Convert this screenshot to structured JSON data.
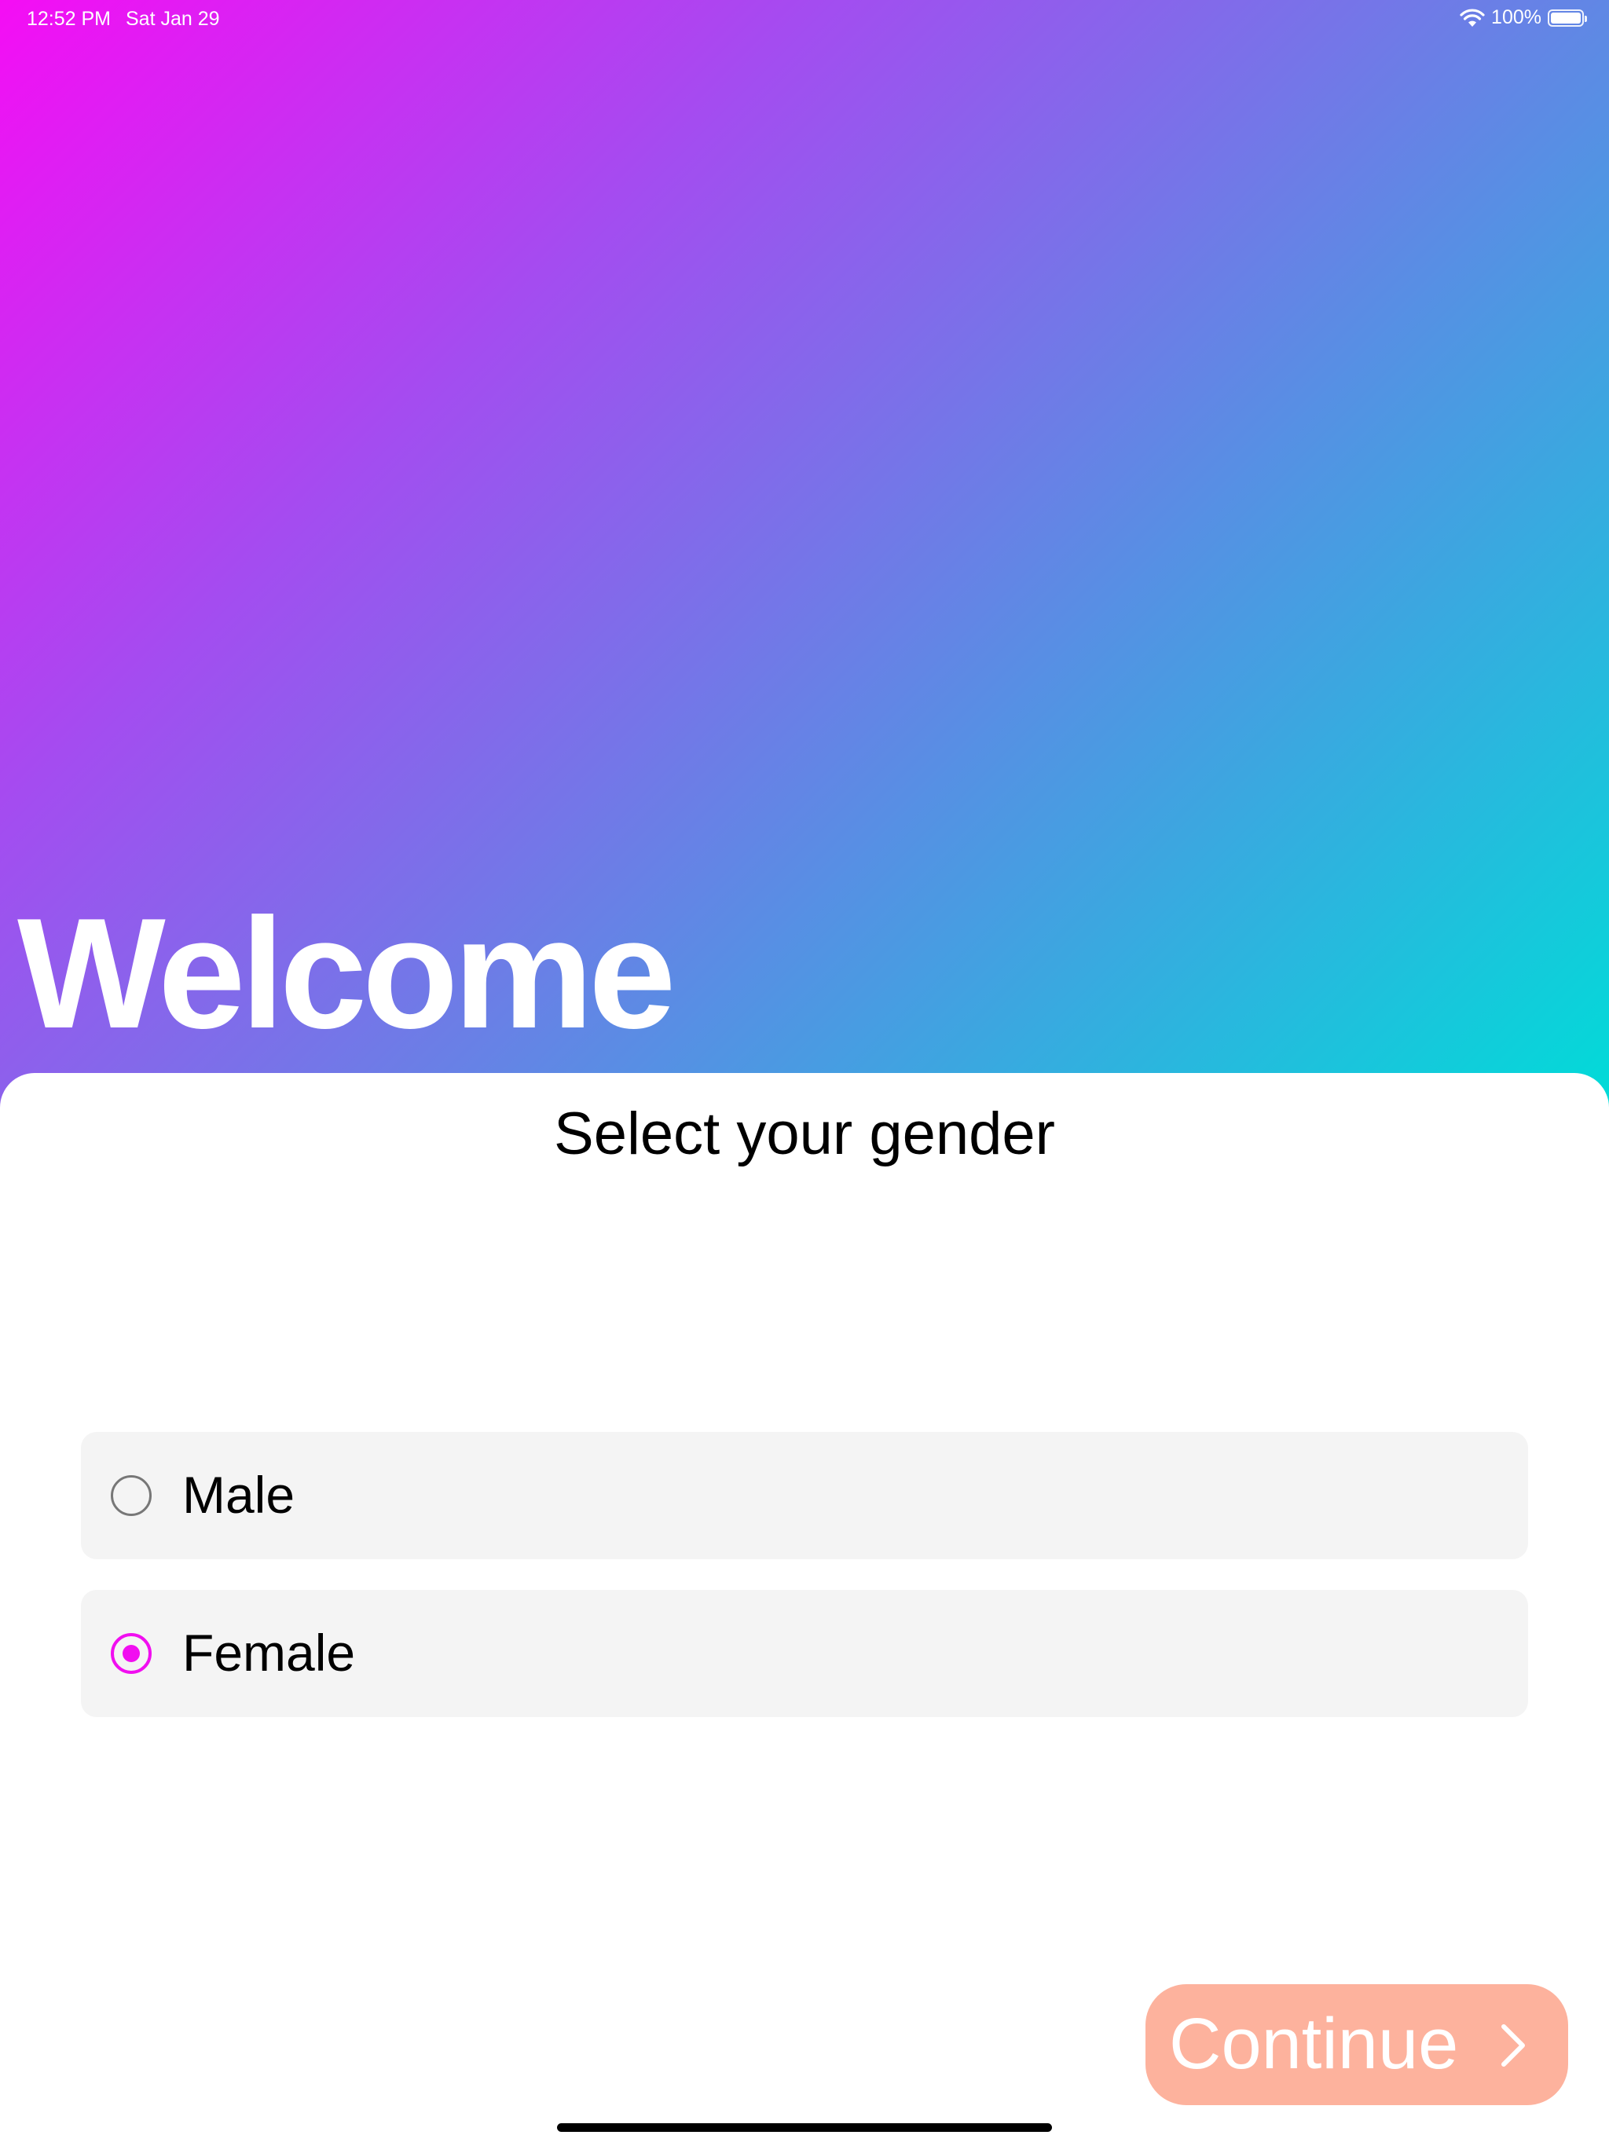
{
  "status_bar": {
    "time": "12:52 PM",
    "date": "Sat Jan 29",
    "battery": "100%",
    "battery_level": 1.0,
    "icons": [
      "wifi-icon",
      "battery-icon"
    ]
  },
  "hero": {
    "title": "Welcome",
    "gradient_colors": [
      "#f50df4",
      "#a44cf0",
      "#6a7fe6",
      "#3aa8e0",
      "#00dcd8"
    ]
  },
  "gender_form": {
    "title": "Select your gender",
    "options": [
      {
        "label": "Male",
        "selected": false
      },
      {
        "label": "Female",
        "selected": true
      }
    ],
    "selected_color": "#f10ef0"
  },
  "continue_button": {
    "label": "Continue",
    "icon": "chevron-right-icon",
    "background": "#fdb29d"
  }
}
